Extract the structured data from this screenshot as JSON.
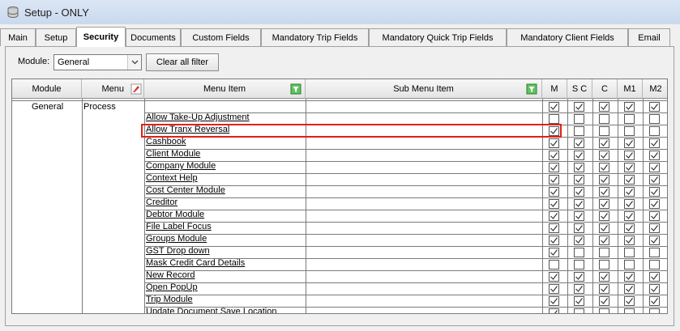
{
  "window": {
    "title": "Setup - ONLY"
  },
  "tabs": [
    "Main",
    "Setup",
    "Security",
    "Documents",
    "Custom Fields",
    "Mandatory Trip Fields",
    "Mandatory Quick Trip Fields",
    "Mandatory Client Fields",
    "Email"
  ],
  "active_tab": "Security",
  "filter": {
    "module_label": "Module:",
    "module_value": "General",
    "clear_button": "Clear all filter"
  },
  "grid": {
    "headers": {
      "module": "Module",
      "menu": "Menu",
      "menu_item": "Menu Item",
      "sub_menu_item": "Sub Menu Item",
      "m": "M",
      "sc": "S C",
      "c": "C",
      "m1": "M1",
      "m2": "M2"
    },
    "module_value": "General",
    "menu_value": "Process",
    "items": [
      "Allow Take-Up Adjustment",
      "Allow Tranx Reversal",
      "Cashbook",
      "Client Module",
      "Company Module",
      "Context Help",
      "Cost Center Module",
      "Creditor",
      "Debtor Module",
      "File Label Focus",
      "Groups Module",
      "GST Drop down",
      "Mask Credit Card Details",
      "New Record",
      "Open PopUp",
      "Trip Module",
      "Update Document Save Location"
    ],
    "checks": [
      [
        1,
        1,
        1,
        1,
        1
      ],
      [
        0,
        0,
        0,
        0,
        0
      ],
      [
        1,
        0,
        0,
        0,
        0
      ],
      [
        1,
        1,
        1,
        1,
        1
      ],
      [
        1,
        1,
        1,
        1,
        1
      ],
      [
        1,
        1,
        1,
        1,
        1
      ],
      [
        1,
        1,
        1,
        1,
        1
      ],
      [
        1,
        1,
        1,
        1,
        1
      ],
      [
        1,
        1,
        1,
        1,
        1
      ],
      [
        1,
        1,
        1,
        1,
        1
      ],
      [
        1,
        1,
        1,
        1,
        1
      ],
      [
        1,
        1,
        1,
        1,
        1
      ],
      [
        1,
        0,
        0,
        0,
        0
      ],
      [
        0,
        0,
        0,
        0,
        0
      ],
      [
        1,
        1,
        1,
        1,
        1
      ],
      [
        1,
        1,
        1,
        1,
        1
      ],
      [
        1,
        1,
        1,
        1,
        1
      ],
      [
        1,
        0,
        0,
        0,
        0
      ]
    ],
    "highlighted_item": "Allow Tranx Reversal"
  },
  "colors": {
    "highlight": "#e0201a",
    "titlebar": "#c9d9ee"
  }
}
